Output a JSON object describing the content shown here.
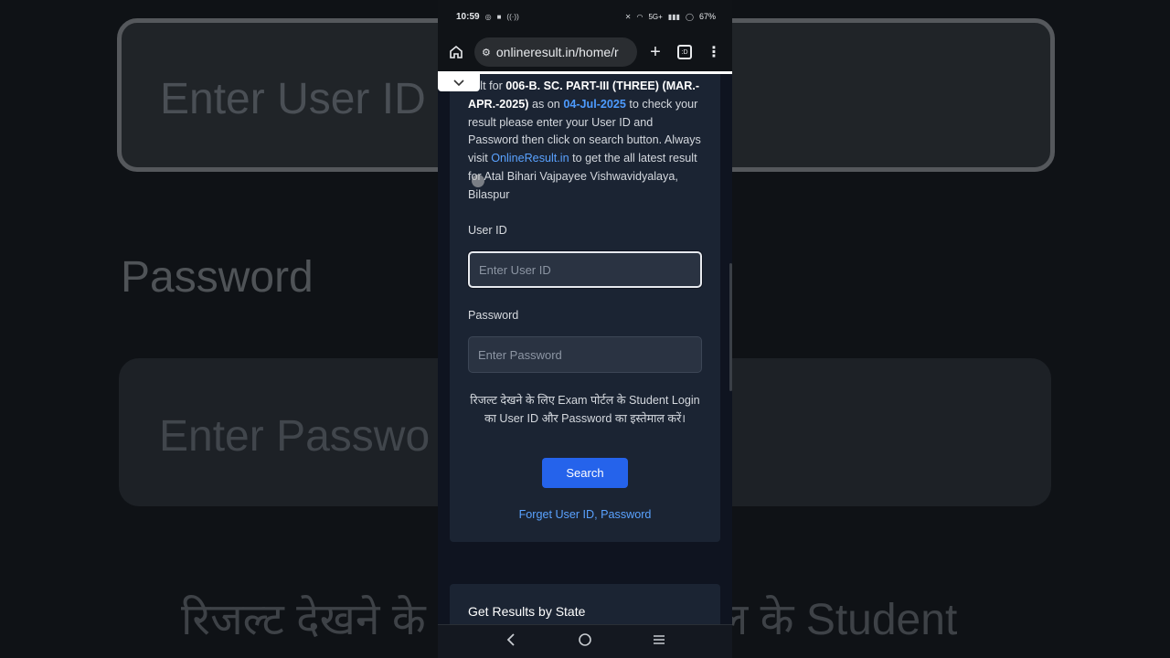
{
  "background": {
    "user_id_placeholder": "Enter User ID",
    "password_label": "Password",
    "password_placeholder": "Enter Passwo",
    "hindi_text_left": "रिजल्ट देखने के",
    "hindi_text_right": "ल के Student"
  },
  "status_bar": {
    "time": "10:59",
    "network": "5G+",
    "battery": "67%"
  },
  "browser": {
    "url": "onlineresult.in/home/r",
    "tab_icon_label": ":D"
  },
  "intro": {
    "prefix": "sult for ",
    "course": "006-B. SC. PART-III (THREE) (MAR.-APR.-2025)",
    "middle": " as on ",
    "date": "04-Jul-2025",
    "body": " to check your result please enter your User ID and Password then click on search button. Always visit ",
    "site_link": "OnlineResult.in",
    "suffix": " to get the all latest result for Atal Bihari Vajpayee Vishwavidyalaya, Bilaspur"
  },
  "form": {
    "user_id_label": "User ID",
    "user_id_placeholder": "Enter User ID",
    "password_label": "Password",
    "password_placeholder": "Enter Password",
    "note": "रिजल्ट देखने के लिए Exam पोर्टल के Student Login का User ID और Password का इस्तेमाल करें।",
    "search_button": "Search",
    "forget_link": "Forget User ID, Password"
  },
  "next_card": {
    "title": "Get Results by State"
  },
  "colors": {
    "accent": "#2563eb",
    "link": "#5aa2ff",
    "card_bg": "#1b2433"
  }
}
